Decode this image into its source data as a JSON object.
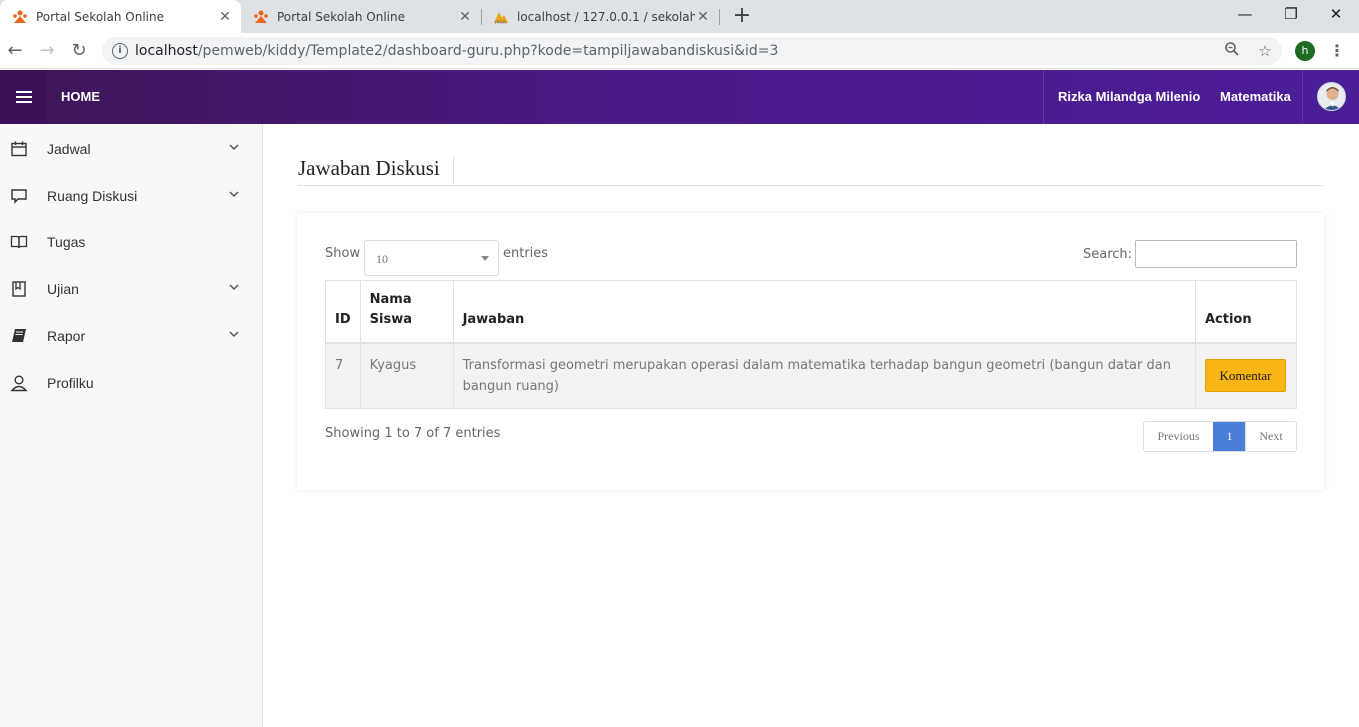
{
  "browser": {
    "tabs": [
      {
        "title": "Portal Sekolah Online",
        "active": true
      },
      {
        "title": "Portal Sekolah Online",
        "active": false
      },
      {
        "title": "localhost / 127.0.0.1 / sekolah / s",
        "active": false
      }
    ],
    "new_tab": "+",
    "url_host": "localhost",
    "url_path": "/pemweb/kiddy/Template2/dashboard-guru.php?kode=tampiljawabandiskusi&id=3",
    "profile_initial": "h"
  },
  "header": {
    "home": "HOME",
    "user_name": "Rizka Milandga Milenio",
    "subject": "Matematika"
  },
  "sidebar": {
    "items": [
      {
        "label": "Jadwal",
        "icon": "calendar-icon",
        "has_submenu": true
      },
      {
        "label": "Ruang Diskusi",
        "icon": "chat-icon",
        "has_submenu": true
      },
      {
        "label": "Tugas",
        "icon": "book-open-icon",
        "has_submenu": false
      },
      {
        "label": "Ujian",
        "icon": "bookmark-icon",
        "has_submenu": true
      },
      {
        "label": "Rapor",
        "icon": "book-icon",
        "has_submenu": true
      },
      {
        "label": "Profilku",
        "icon": "user-icon",
        "has_submenu": false
      }
    ]
  },
  "main": {
    "title": "Jawaban Diskusi",
    "length": {
      "show": "Show",
      "value": "10",
      "entries": "entries"
    },
    "search_label": "Search:",
    "search_value": "",
    "table": {
      "headers": {
        "id": "ID",
        "nama_siswa": "Nama Siswa",
        "jawaban": "Jawaban",
        "action": "Action"
      },
      "rows": [
        {
          "id": "7",
          "nama_siswa": "Kyagus",
          "jawaban": "Transformasi geometri merupakan operasi dalam matematika terhadap bangun geometri (bangun datar dan bangun ruang)",
          "action_label": "Komentar"
        }
      ]
    },
    "info": "Showing 1 to 7 of 7 entries",
    "pagination": {
      "previous": "Previous",
      "current": "1",
      "next": "Next"
    }
  },
  "colors": {
    "header_gradient_start": "#3d1656",
    "header_gradient_end": "#4b1d98",
    "button_warning": "#f8b514",
    "pagination_active": "#4a7ed8"
  }
}
